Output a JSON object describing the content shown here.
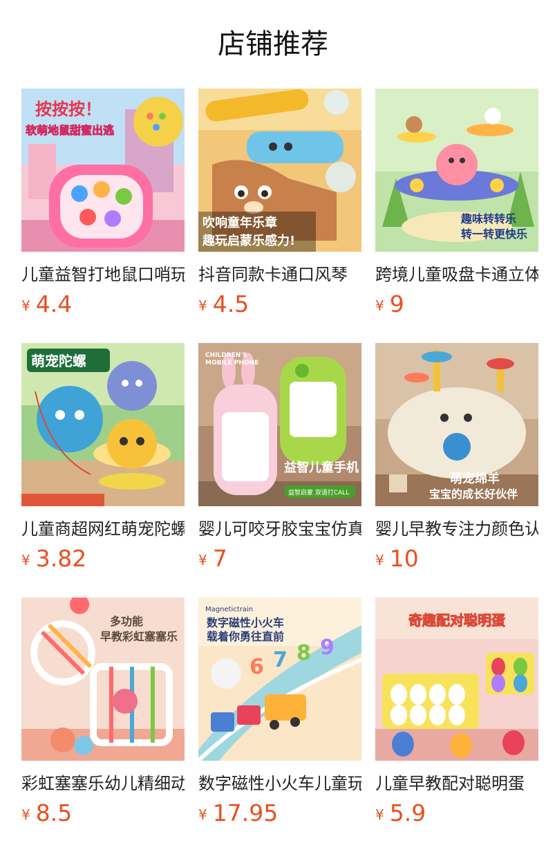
{
  "page": {
    "title": "店铺推荐"
  },
  "theme": {
    "price_color": "#e8501f"
  },
  "products": [
    {
      "name": "儿童益智打地鼠口哨玩具",
      "currency": "¥",
      "price": "4.4",
      "image": {
        "icon": "pink-whack-a-mole-toy-image",
        "overlay": [
          "按按按！",
          "软萌地鼠甜蜜出逃"
        ]
      }
    },
    {
      "name": "抖音同款卡通口风琴",
      "currency": "¥",
      "price": "4.5",
      "image": {
        "icon": "cartoon-harmonica-image",
        "overlay": [
          "吹响童年乐章",
          "趣玩启蒙乐感力!"
        ]
      }
    },
    {
      "name": "跨境儿童吸盘卡通立体陀螺",
      "currency": "¥",
      "price": "9",
      "image": {
        "icon": "suction-spinner-toy-image",
        "overlay": [
          "趣味转转乐",
          "转一转更快乐"
        ]
      }
    },
    {
      "name": "儿童商超网红萌宠陀螺玩具",
      "currency": "¥",
      "price": "3.82",
      "image": {
        "icon": "cute-pet-spinning-top-image",
        "overlay": [
          "萌宠陀螺"
        ]
      }
    },
    {
      "name": "婴儿可咬牙胶宝宝仿真手机",
      "currency": "¥",
      "price": "7",
      "image": {
        "icon": "baby-toy-phone-image",
        "overlay": [
          "CHILDREN'S",
          "MOBILE PHONE",
          "益智儿童手机",
          "益智启蒙 双语打CALL"
        ]
      }
    },
    {
      "name": "婴儿早教专注力颜色认知玩具",
      "currency": "¥",
      "price": "10",
      "image": {
        "icon": "lamb-busy-toy-image",
        "overlay": [
          "萌宠绵羊",
          "宝宝的成长好伙伴"
        ]
      }
    },
    {
      "name": "彩虹塞塞乐幼儿精细动作",
      "currency": "¥",
      "price": "8.5",
      "image": {
        "icon": "rainbow-sorting-cube-image",
        "overlay": [
          "多功能",
          "早教彩虹塞塞乐"
        ]
      }
    },
    {
      "name": "数字磁性小火车儿童玩具",
      "currency": "¥",
      "price": "17.95",
      "image": {
        "icon": "magnetic-number-train-image",
        "overlay": [
          "Magnetictrain",
          "数字磁性小火车",
          "载着你勇往直前"
        ]
      }
    },
    {
      "name": "儿童早教配对聪明蛋",
      "currency": "¥",
      "price": "5.9",
      "image": {
        "icon": "matching-eggs-image",
        "overlay": [
          "奇趣配对聪明蛋"
        ]
      }
    }
  ]
}
